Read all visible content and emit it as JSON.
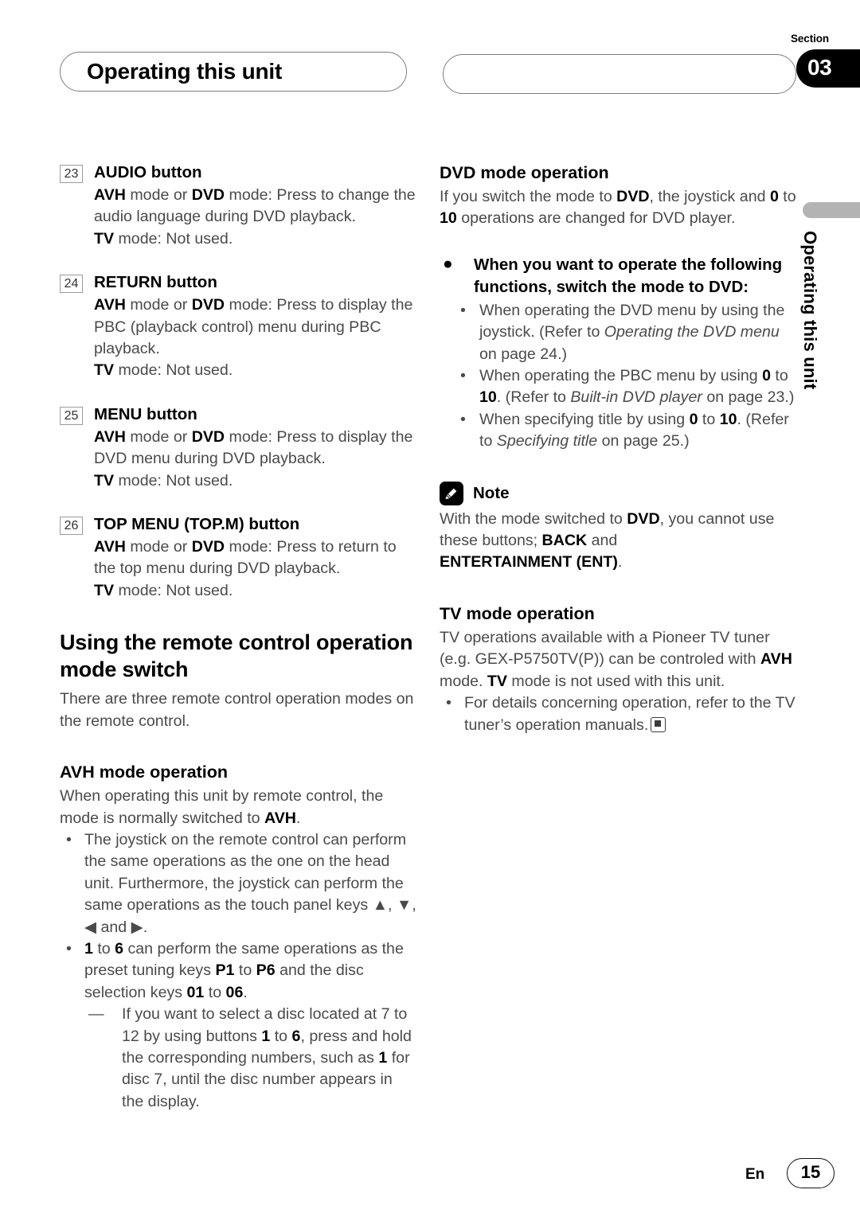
{
  "header": {
    "chapter_title": "Operating this unit",
    "section_label": "Section",
    "section_number": "03"
  },
  "side_tab": {
    "text": "Operating this unit"
  },
  "left_column": {
    "numbered_items": [
      {
        "number": "23",
        "title": "AUDIO button",
        "line1_bold_a": "AVH",
        "line1_mid": " mode or ",
        "line1_bold_b": "DVD",
        "line1_rest": " mode: Press to change the audio language during DVD playback.",
        "line2_bold": "TV",
        "line2_rest": " mode: Not used."
      },
      {
        "number": "24",
        "title": "RETURN button",
        "line1_bold_a": "AVH",
        "line1_mid": " mode or ",
        "line1_bold_b": "DVD",
        "line1_rest": " mode: Press to display the PBC (playback control) menu during PBC playback.",
        "line2_bold": "TV",
        "line2_rest": " mode: Not used."
      },
      {
        "number": "25",
        "title": "MENU button",
        "line1_bold_a": "AVH",
        "line1_mid": " mode or ",
        "line1_bold_b": "DVD",
        "line1_rest": " mode: Press to display the DVD menu during DVD playback.",
        "line2_bold": "TV",
        "line2_rest": " mode: Not used."
      },
      {
        "number": "26",
        "title": "TOP MENU (TOP.M) button",
        "line1_bold_a": "AVH",
        "line1_mid": " mode or ",
        "line1_bold_b": "DVD",
        "line1_rest": " mode: Press to return to the top menu during DVD playback.",
        "line2_bold": "TV",
        "line2_rest": " mode: Not used."
      }
    ],
    "section_heading": "Using the remote control operation mode switch",
    "section_intro": "There are three remote control operation modes on the remote control.",
    "avh_heading_bold": "AVH",
    "avh_heading_rest": " mode operation",
    "avh_intro_a": "When operating this unit by remote control, the mode is normally switched to ",
    "avh_intro_bold": "AVH",
    "avh_intro_b": ".",
    "bullet1": "The joystick on the remote control can perform the same operations as the one on the head unit. Furthermore, the joystick can perform the same operations as the touch panel keys ▲, ▼, ◀ and ▶.",
    "bullet2": {
      "b1": "1",
      "t1": " to ",
      "b2": "6",
      "t2": " can perform the same operations as the preset tuning keys ",
      "b3": "P1",
      "t3": " to ",
      "b4": "P6",
      "t4": " and the disc selection keys ",
      "b5": "01",
      "t5": " to ",
      "b6": "06",
      "t6": "."
    },
    "subbullet": {
      "t1": "If you want to select a disc located at 7 to 12 by using buttons ",
      "b1": "1",
      "t2": " to ",
      "b2": "6",
      "t3": ", press and hold the corresponding numbers, such as ",
      "b3": "1",
      "t4": " for disc 7, until the disc number appears in the display."
    },
    "dash_glyph": "—",
    "bullet_glyph": "•"
  },
  "right_column": {
    "dvd_heading_bold": "DVD",
    "dvd_heading_rest": " mode operation",
    "dvd_intro": {
      "t1": "If you switch the mode to ",
      "b1": "DVD",
      "t2": ", the joystick and ",
      "b2": "0",
      "t3": " to ",
      "b3": "10",
      "t4": " operations are changed for DVD player."
    },
    "bigdot_glyph": "●",
    "bigdot_heading": "When you want to operate the following functions, switch the mode to DVD:",
    "dvd_bullets": [
      {
        "t1": "When operating the DVD menu by using the joystick. (Refer to ",
        "i1": "Operating the DVD menu",
        "t2": " on page 24.)"
      },
      {
        "t1": "When operating the PBC menu by using ",
        "b1": "0",
        "t2": " to ",
        "b2": "10",
        "t3": ". (Refer to ",
        "i1": "Built-in DVD player",
        "t4": " on page 23.)"
      },
      {
        "t1": "When specifying title by using ",
        "b1": "0",
        "t2": " to ",
        "b2": "10",
        "t3": ". (Refer to ",
        "i1": "Specifying title",
        "t4": " on page 25.)"
      }
    ],
    "note": {
      "title": "Note",
      "icon": "pencil-icon",
      "t1": "With the mode switched to ",
      "b1": "DVD",
      "t2": ", you cannot use these buttons; ",
      "b2": "BACK",
      "t3": " and ",
      "b3": "ENTERTAINMENT (ENT)",
      "t4": "."
    },
    "tv_heading_bold": "TV",
    "tv_heading_rest": " mode operation",
    "tv_intro": {
      "t1": "TV operations available with a Pioneer TV tuner (e.g. GEX-P5750TV(P)) can be controled with ",
      "b1": "AVH",
      "t2": " mode. ",
      "b2": "TV",
      "t3": " mode is not used with this unit."
    },
    "tv_bullet": "For details concerning operation, refer to the TV tuner’s operation manuals.",
    "bullet_glyph": "•"
  },
  "footer": {
    "language": "En",
    "page_number": "15"
  }
}
